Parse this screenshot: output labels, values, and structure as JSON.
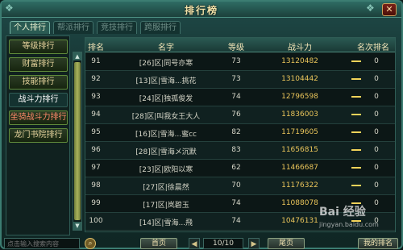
{
  "window": {
    "title": "排行榜",
    "close_label": "✕"
  },
  "tabs": [
    {
      "label": "个人排行",
      "active": true
    },
    {
      "label": "帮派排行",
      "active": false
    },
    {
      "label": "竞技排行",
      "active": false
    },
    {
      "label": "跨服排行",
      "active": false
    }
  ],
  "sidebar": {
    "items": [
      {
        "label": "等级排行"
      },
      {
        "label": "财富排行"
      },
      {
        "label": "技能排行"
      },
      {
        "label": "战斗力排行"
      },
      {
        "label": "坐骑战斗力排行"
      },
      {
        "label": "龙门书院排行"
      }
    ]
  },
  "table": {
    "headers": {
      "rank": "排名",
      "name": "名字",
      "level": "等级",
      "power": "战斗力",
      "change": "名次排名"
    },
    "rows": [
      {
        "rank": "91",
        "name": "[26]区|同号亦寒",
        "level": "73",
        "power": "13120482",
        "change": "0"
      },
      {
        "rank": "92",
        "name": "[13]区|雪海...挑花",
        "level": "73",
        "power": "13104442",
        "change": "0"
      },
      {
        "rank": "93",
        "name": "[24]区|独孤俊发",
        "level": "74",
        "power": "12796598",
        "change": "0"
      },
      {
        "rank": "94",
        "name": "[28]区|叫我女王大人",
        "level": "76",
        "power": "11836003",
        "change": "0"
      },
      {
        "rank": "95",
        "name": "[16]区|雪海...蜜cc",
        "level": "82",
        "power": "11719605",
        "change": "0"
      },
      {
        "rank": "96",
        "name": "[28]区|雪海メ沉默",
        "level": "83",
        "power": "11656815",
        "change": "0"
      },
      {
        "rank": "97",
        "name": "[23]区|欧阳以寒",
        "level": "62",
        "power": "11466687",
        "change": "0"
      },
      {
        "rank": "98",
        "name": "[27]区|徐晨然",
        "level": "70",
        "power": "11176322",
        "change": "0"
      },
      {
        "rank": "99",
        "name": "[17]区|岚碧玉",
        "level": "74",
        "power": "11088078",
        "change": "0"
      },
      {
        "rank": "100",
        "name": "[14]区|雪海...飛",
        "level": "74",
        "power": "10476131",
        "change": "0"
      }
    ]
  },
  "footer": {
    "search_placeholder": "点击输入搜索内容",
    "first_page": "首页",
    "page_indicator": "10/10",
    "last_page": "尾页",
    "my_rank": "我的排名",
    "prev_arrow": "◀",
    "next_arrow": "▶"
  },
  "watermark": {
    "logo": "Bai 经验",
    "url": "jingyan.baidu.com"
  },
  "colors": {
    "accent": "#e9c45a",
    "frame": "#3c7d72",
    "background": "#102624"
  }
}
